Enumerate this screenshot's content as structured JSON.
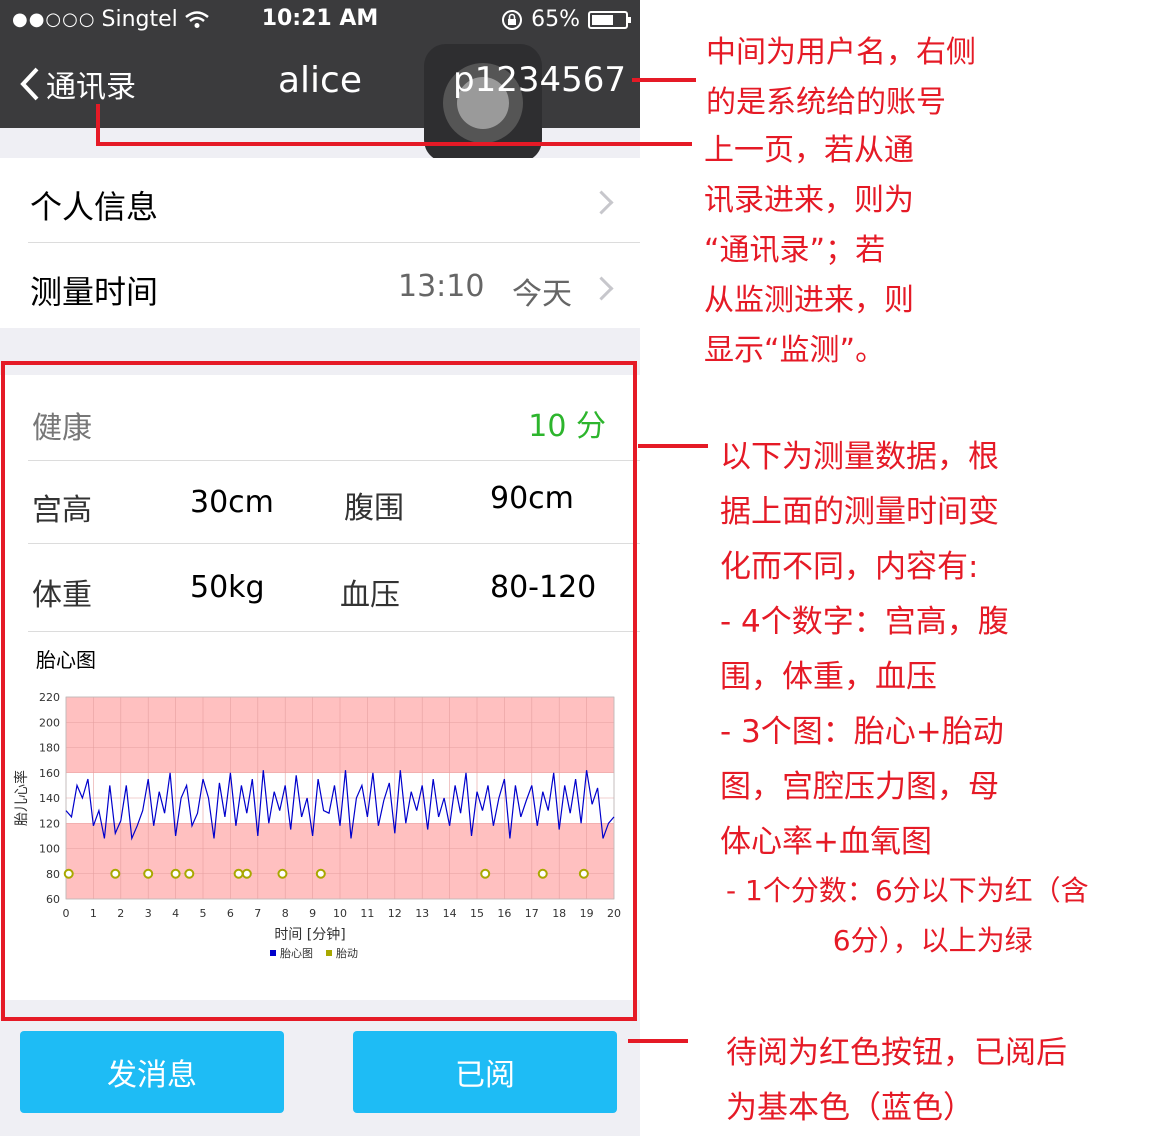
{
  "status_bar": {
    "signal": "●●○○○",
    "carrier": "Singtel",
    "time": "10:21 AM",
    "battery_percent": 65,
    "battery_label": "65%"
  },
  "nav": {
    "back_label": "通讯录",
    "title": "alice",
    "account": "p1234567"
  },
  "rows": {
    "personal_info": "个人信息",
    "measure_time_label": "测量时间",
    "measure_time": "13:10",
    "measure_day": "今天"
  },
  "health": {
    "label": "健康",
    "score": "10  分"
  },
  "metrics": {
    "fundal_height_label": "宫高",
    "fundal_height": "30cm",
    "abdomen_label": "腹围",
    "abdomen": "90cm",
    "weight_label": "体重",
    "weight": "50kg",
    "bp_label": "血压",
    "bp": "80-120"
  },
  "buttons": {
    "send_message": "发消息",
    "read": "已阅"
  },
  "colors": {
    "nav_bg": "#3b3b3d",
    "accent_blue": "#1ebcf5",
    "score_green": "#2db52d",
    "annotation_red": "#e51a26",
    "band_pink": "#ffc0c0"
  },
  "annotations": {
    "a1": "中间为用户名，右侧\n的是系统给的账号",
    "a2": "上一页，若从通\n讯录进来，则为\n“通讯录”；若\n从监测进来，则\n显示“监测”。",
    "a3": "以下为测量数据，根\n据上面的测量时间变\n化而不同，内容有:\n- 4个数字：宫高，腹\n围，体重，血压\n- 3个图：胎心+胎动\n图，宫腔压力图，母\n体心率+血氧图",
    "a4": "- 1个分数：6分以下为红（含\n            6分），以上为绿",
    "a5": "待阅为红色按钮，已阅后\n为基本色（蓝色）"
  },
  "chart_data": {
    "type": "line",
    "title": "胎心图",
    "xlabel": "时间 [分钟]",
    "ylabel": "胎儿心率",
    "xlim": [
      0,
      20
    ],
    "ylim": [
      60,
      220
    ],
    "x_ticks": [
      "0",
      "1",
      "2",
      "3",
      "4",
      "5",
      "6",
      "7",
      "8",
      "9",
      "10",
      "11",
      "12",
      "13",
      "14",
      "15",
      "16",
      "17",
      "18",
      "19",
      "20"
    ],
    "y_ticks": [
      "60",
      "80",
      "100",
      "120",
      "140",
      "160",
      "180",
      "200",
      "220"
    ],
    "normal_band": [
      120,
      160
    ],
    "grid": true,
    "legend_position": "bottom",
    "series": [
      {
        "name": "胎心图",
        "color": "#0000cc",
        "kind": "line",
        "x": [
          0,
          0.2,
          0.4,
          0.6,
          0.8,
          1.0,
          1.2,
          1.4,
          1.6,
          1.8,
          2.0,
          2.2,
          2.4,
          2.6,
          2.8,
          3.0,
          3.2,
          3.4,
          3.6,
          3.8,
          4.0,
          4.2,
          4.4,
          4.6,
          4.8,
          5.0,
          5.2,
          5.4,
          5.6,
          5.8,
          6.0,
          6.2,
          6.4,
          6.6,
          6.8,
          7.0,
          7.2,
          7.4,
          7.6,
          7.8,
          8.0,
          8.2,
          8.4,
          8.6,
          8.8,
          9.0,
          9.2,
          9.4,
          9.6,
          9.8,
          10.0,
          10.2,
          10.4,
          10.6,
          10.8,
          11.0,
          11.2,
          11.4,
          11.6,
          11.8,
          12.0,
          12.2,
          12.4,
          12.6,
          12.8,
          13.0,
          13.2,
          13.4,
          13.6,
          13.8,
          14.0,
          14.2,
          14.4,
          14.6,
          14.8,
          15.0,
          15.2,
          15.4,
          15.6,
          15.8,
          16.0,
          16.2,
          16.4,
          16.6,
          16.8,
          17.0,
          17.2,
          17.4,
          17.6,
          17.8,
          18.0,
          18.2,
          18.4,
          18.6,
          18.8,
          19.0,
          19.2,
          19.4,
          19.6,
          19.8,
          20.0
        ],
        "y": [
          130,
          125,
          150,
          140,
          155,
          118,
          130,
          108,
          150,
          112,
          122,
          150,
          108,
          118,
          130,
          155,
          118,
          145,
          128,
          160,
          110,
          140,
          150,
          118,
          128,
          155,
          140,
          108,
          152,
          125,
          160,
          118,
          150,
          128,
          155,
          110,
          162,
          120,
          145,
          130,
          150,
          115,
          158,
          125,
          140,
          110,
          155,
          130,
          128,
          150,
          118,
          162,
          108,
          140,
          150,
          125,
          160,
          118,
          138,
          152,
          112,
          162,
          120,
          145,
          130,
          150,
          115,
          155,
          125,
          140,
          118,
          150,
          128,
          160,
          110,
          145,
          130,
          150,
          118,
          140,
          155,
          108,
          150,
          125,
          138,
          150,
          118,
          145,
          130,
          160,
          115,
          150,
          128,
          155,
          120,
          162,
          135,
          148,
          108,
          120,
          125
        ]
      },
      {
        "name": "胎动",
        "color": "#a8a800",
        "kind": "points",
        "x": [
          0.1,
          1.8,
          3.0,
          4.0,
          4.5,
          6.3,
          6.6,
          7.9,
          9.3,
          15.3,
          17.4,
          18.9
        ],
        "y": [
          80,
          80,
          80,
          80,
          80,
          80,
          80,
          80,
          80,
          80,
          80,
          80
        ]
      }
    ]
  }
}
